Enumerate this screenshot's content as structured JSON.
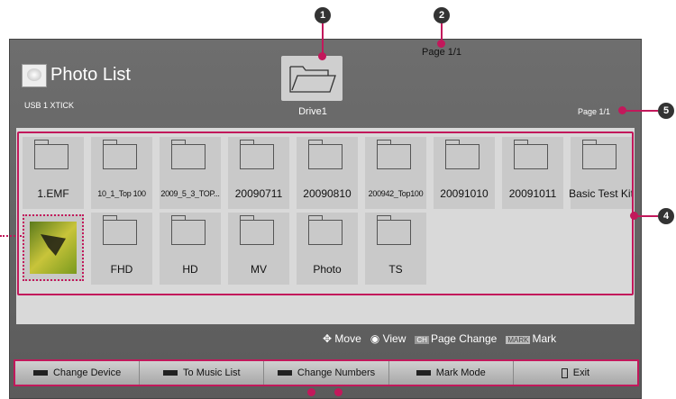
{
  "header": {
    "title": "Photo List",
    "device": "USB 1 XTICK",
    "drive": "Drive1",
    "page_top": "Page 1/1",
    "page_right": "Page 1/1"
  },
  "items": [
    {
      "label": "1.EMF"
    },
    {
      "label": "10_1_Top 100"
    },
    {
      "label": "2009_5_3_TOP..."
    },
    {
      "label": "20090711"
    },
    {
      "label": "20090810"
    },
    {
      "label": "200942_Top100"
    },
    {
      "label": "20091010"
    },
    {
      "label": "20091011"
    },
    {
      "label": "Basic Test Kit"
    },
    {
      "label": "FHD"
    },
    {
      "label": "HD"
    },
    {
      "label": "MV"
    },
    {
      "label": "Photo"
    },
    {
      "label": "TS"
    }
  ],
  "controls": {
    "move": "Move",
    "view": "View",
    "page_change": "Page Change",
    "mark": "Mark",
    "ch": "CH",
    "mark_badge": "MARK"
  },
  "buttons": {
    "change_device": "Change Device",
    "to_music": "To Music List",
    "change_numbers": "Change Numbers",
    "mark_mode": "Mark Mode",
    "exit": "Exit"
  },
  "callouts": {
    "c1": "1",
    "c2": "2",
    "c4": "4",
    "c5": "5"
  },
  "colors": {
    "accent": "#c2185b",
    "screen": "#636363",
    "tile": "#c9c9c9"
  }
}
